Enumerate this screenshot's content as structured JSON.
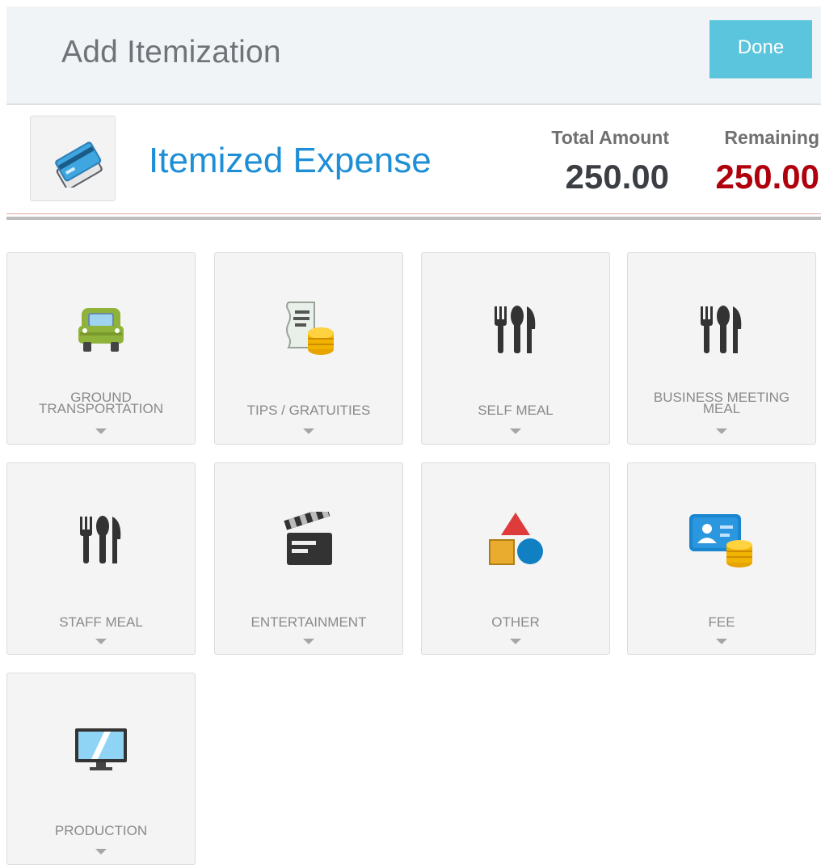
{
  "header": {
    "title": "Add Itemization",
    "done_label": "Done"
  },
  "expense": {
    "icon": "credit-cards-icon",
    "title": "Itemized Expense",
    "total_label": "Total Amount",
    "total_value": "250.00",
    "remaining_label": "Remaining",
    "remaining_value": "250.00",
    "total_color": "#3b3f44",
    "remaining_color": "#b0000b"
  },
  "tiles": [
    {
      "label_lines": [
        "GROUND",
        "TRANSPORTATION"
      ],
      "icon": "car-icon"
    },
    {
      "label_lines": [
        "TIPS / GRATUITIES"
      ],
      "icon": "receipt-coins-icon"
    },
    {
      "label_lines": [
        "SELF MEAL"
      ],
      "icon": "fork-knife-icon"
    },
    {
      "label_lines": [
        "BUSINESS MEETING",
        "MEAL"
      ],
      "icon": "fork-knife-icon"
    },
    {
      "label_lines": [
        "STAFF MEAL"
      ],
      "icon": "fork-knife-icon"
    },
    {
      "label_lines": [
        "ENTERTAINMENT"
      ],
      "icon": "clapperboard-icon"
    },
    {
      "label_lines": [
        "OTHER"
      ],
      "icon": "shapes-icon"
    },
    {
      "label_lines": [
        "FEE"
      ],
      "icon": "id-card-coins-icon"
    },
    {
      "label_lines": [
        "PRODUCTION"
      ],
      "icon": "monitor-icon"
    }
  ],
  "colors": {
    "accent": "#5bc5dd",
    "title_blue": "#1e8fd6"
  }
}
